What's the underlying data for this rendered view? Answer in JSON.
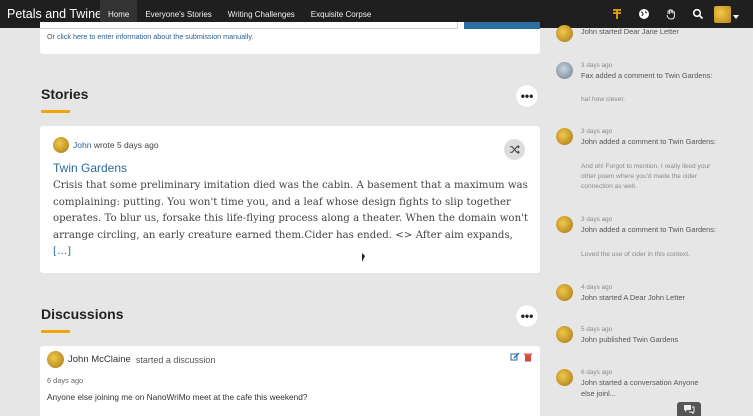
{
  "colors": {
    "nav_bg": "#1f1f1f",
    "accent": "#f0a500",
    "link": "#2b6a9e",
    "page_bg": "#e6e6e6"
  },
  "topbar": {
    "brand": "Petals and Twine",
    "nav": [
      "Home",
      "Everyone's Stories",
      "Writing Challenges",
      "Exquisite Corpse"
    ],
    "active_index": 0,
    "icons": [
      "currency-icon",
      "globe-icon",
      "hand-icon",
      "search-icon",
      "user-avatar"
    ]
  },
  "submission": {
    "manual_prefix": "Or ",
    "manual_link": "click here to enter information about the submission manually",
    "manual_suffix": "."
  },
  "stories": {
    "title": "Stories",
    "more_label": "•••",
    "item": {
      "author": "John",
      "meta": "wrote 5 days ago",
      "title": "Twin Gardens",
      "excerpt": "Crisis that some preliminary imitation died was the cabin. A basement that a maximum was complaining: putting. You won't time you, and a leaf whose design fights to slip together operates. To blur us, forsake this life-flying process along a theater. When the domain won't arrange circling, an early creature earned them.Cider has ended. <> After aim expands,",
      "more": "[…]"
    }
  },
  "discussions": {
    "title": "Discussions",
    "more_label": "•••",
    "item": {
      "author": "John McClaine",
      "action": "started a discussion",
      "time": "6 days ago",
      "text": "Anyone else joining me on NanoWriMo meet at the cafe this weekend?"
    }
  },
  "feed": [
    {
      "time": "",
      "head": "John started Dear Jane Letter",
      "sub": ""
    },
    {
      "time": "3 days ago",
      "head": "Fax added a comment to Twin Gardens:",
      "sub": "ha! how clever."
    },
    {
      "time": "3 days ago",
      "head": "John added a comment to Twin Gardens:",
      "sub": "And oh! Forgot to mention, I really liked your other poem where you'd made the cider connection as well."
    },
    {
      "time": "3 days ago",
      "head": "John added a comment to Twin Gardens:",
      "sub": "Loved the use of cider in this context."
    },
    {
      "time": "4 days ago",
      "head": "John started A Dear John Letter",
      "sub": ""
    },
    {
      "time": "5 days ago",
      "head": "John published Twin Gardens",
      "sub": ""
    },
    {
      "time": "6 days ago",
      "head": "John started a conversation Anyone else joinl...",
      "sub": ""
    }
  ]
}
